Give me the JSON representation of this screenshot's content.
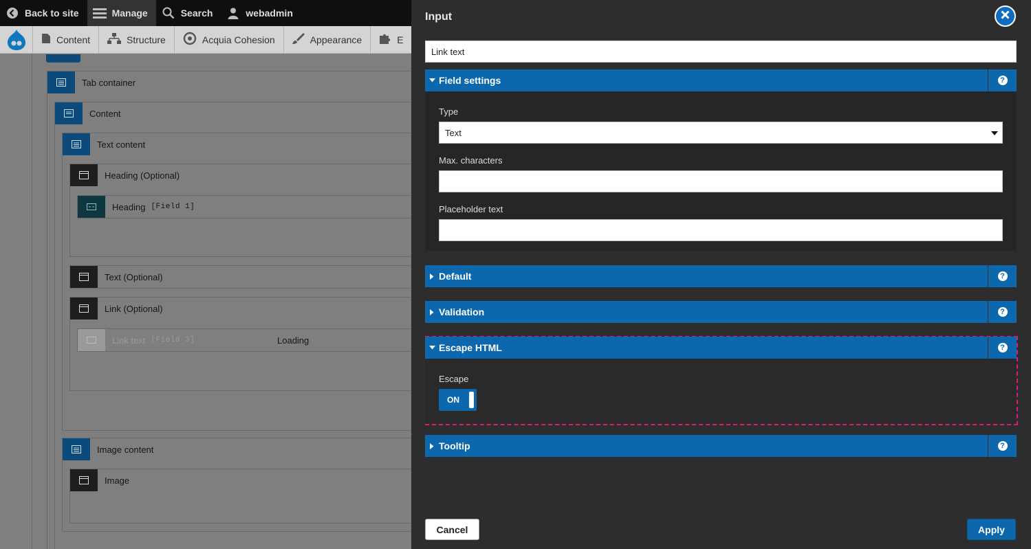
{
  "toolbar": {
    "back_label": "Back to site",
    "manage_label": "Manage",
    "search_label": "Search",
    "user_label": "webadmin"
  },
  "tray": {
    "items": [
      "Content",
      "Structure",
      "Acquia Cohesion",
      "Appearance",
      "E"
    ]
  },
  "canvas": {
    "tab_container": "Tab container",
    "content": "Content",
    "text_content": "Text content",
    "heading_optional": "Heading (Optional)",
    "heading_field": "Heading",
    "heading_field_tag": "[Field 1]",
    "text_optional": "Text (Optional)",
    "link_optional": "Link (Optional)",
    "link_field": "Link text",
    "link_field_tag": "[Field 3]",
    "loading": "Loading",
    "image_content": "Image content",
    "image": "Image"
  },
  "panel": {
    "title": "Input",
    "name_value": "Link text",
    "sections": {
      "field_settings": "Field settings",
      "default": "Default",
      "validation": "Validation",
      "escape_html": "Escape HTML",
      "tooltip": "Tooltip"
    },
    "help_glyph": "?",
    "fields": {
      "type_label": "Type",
      "type_value": "Text",
      "max_label": "Max. characters",
      "max_value": "",
      "placeholder_label": "Placeholder text",
      "placeholder_value": ""
    },
    "escape": {
      "label": "Escape",
      "toggle_text": "ON"
    },
    "cancel_label": "Cancel",
    "apply_label": "Apply"
  },
  "colors": {
    "accent": "#0c67ad",
    "panel_bg": "#2d2d2d",
    "highlight_border": "#e1197c",
    "toolbar_bg": "#0f0f0f"
  }
}
